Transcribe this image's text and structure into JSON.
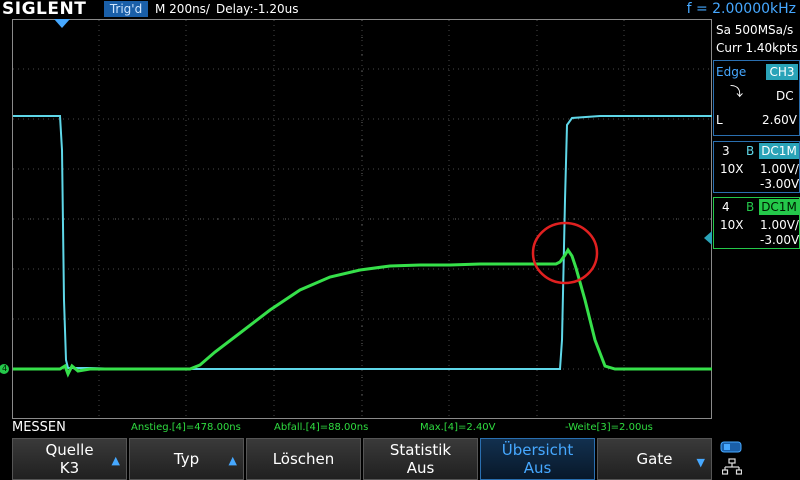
{
  "header": {
    "brand": "SIGLENT",
    "trigger_state": "Trig'd",
    "timebase": "M 200ns/",
    "delay": "Delay:-1.20us",
    "frequency": "f = 2.00000kHz"
  },
  "acquisition": {
    "sample_rate": "Sa 500MSa/s",
    "memory": "Curr 1.40kpts"
  },
  "trigger": {
    "type": "Edge",
    "source": "CH3",
    "coupling": "DC",
    "level_label": "L",
    "level": "2.60V"
  },
  "channels": [
    {
      "number": "3",
      "bw": "B",
      "coupling": "DC1M",
      "probe": "10X",
      "scale": "1.00V/",
      "offset": "-3.00V",
      "color": "#5fd7e8"
    },
    {
      "number": "4",
      "bw": "B",
      "coupling": "DC1M",
      "probe": "10X",
      "scale": "1.00V/",
      "offset": "-3.00V",
      "color": "#24c84a"
    }
  ],
  "markers": {
    "ground_ch4": "4"
  },
  "measurements": {
    "title": "MESSEN",
    "items": [
      "Anstieg.[4]=478.00ns",
      "Abfall.[4]=88.00ns",
      "Max.[4]=2.40V",
      "-Weite[3]=2.00us"
    ]
  },
  "softkeys": [
    {
      "line1": "Quelle",
      "line2": "K3",
      "has_arrow": true
    },
    {
      "line1": "Typ",
      "line2": "",
      "has_arrow": true
    },
    {
      "line1": "Löschen",
      "line2": "",
      "has_arrow": false
    },
    {
      "line1": "Statistik",
      "line2": "Aus",
      "has_arrow": false
    },
    {
      "line1": "Übersicht",
      "line2": "Aus",
      "has_arrow": false,
      "active": true
    },
    {
      "line1": "Gate",
      "line2": "",
      "has_arrow": true
    }
  ],
  "icons": {
    "network": "network-icon",
    "usb": "usb-icon"
  }
}
